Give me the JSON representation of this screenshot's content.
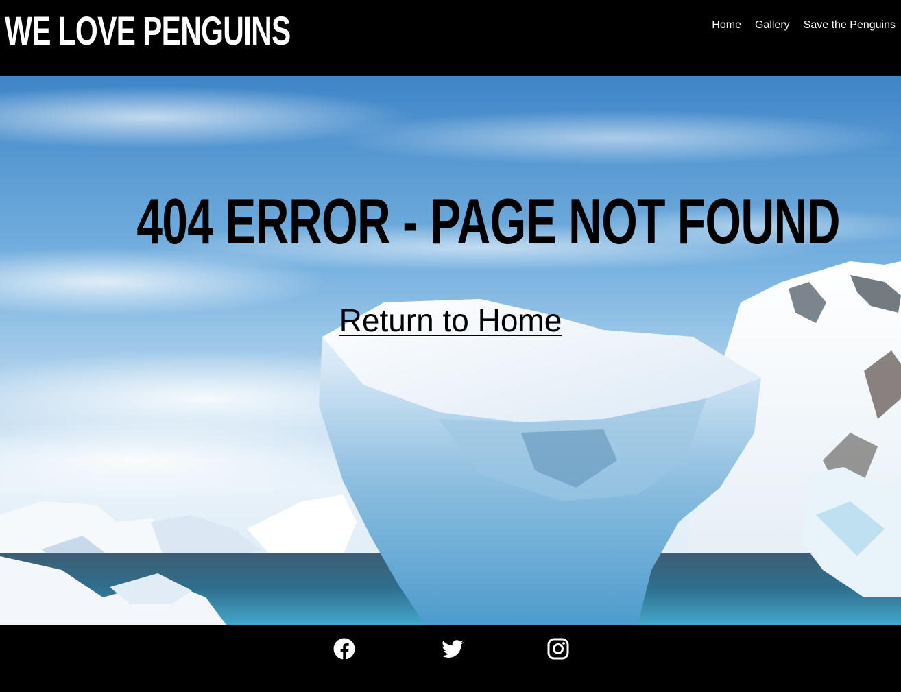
{
  "header": {
    "logo_text": "WE LOVE PENGUINS",
    "nav": [
      {
        "label": "Home"
      },
      {
        "label": "Gallery"
      },
      {
        "label": "Save the Penguins"
      }
    ]
  },
  "hero": {
    "heading": "404 ERROR - PAGE NOT FOUND",
    "return_link": "Return to Home"
  },
  "footer": {
    "social_icons": [
      "facebook-icon",
      "twitter-icon",
      "instagram-icon"
    ]
  },
  "colors": {
    "header_bg": "#000000",
    "footer_bg": "#000000",
    "text_light": "#ffffff",
    "text_dark": "#000000",
    "sky": "#6fa8d8"
  }
}
